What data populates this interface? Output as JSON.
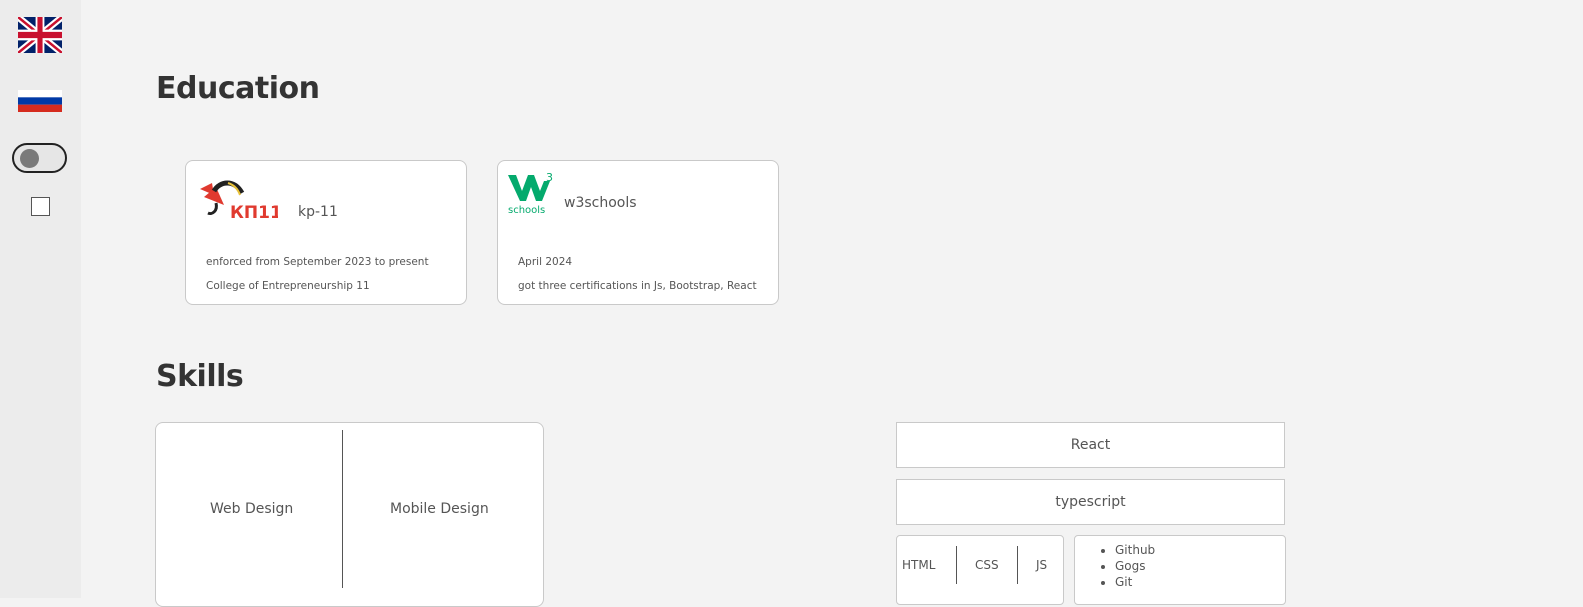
{
  "sidebar": {
    "languages": [
      {
        "code": "en",
        "icon": "uk-flag-icon"
      },
      {
        "code": "ru",
        "icon": "russia-flag-icon"
      }
    ],
    "theme_toggle": {
      "state": "off"
    },
    "checkbox": {
      "checked": false
    }
  },
  "education": {
    "heading": "Education",
    "cards": [
      {
        "logo": "kp11-logo",
        "logo_text": "КП11",
        "title": "kp-11",
        "line1": "enforced from September 2023 to present",
        "line2": "College of Entrepreneurship 11"
      },
      {
        "logo": "w3schools-logo",
        "logo_text": "schools",
        "logo_sup": "3",
        "title": "w3schools",
        "line1": "April 2024",
        "line2": "got three certifications in Js, Bootstrap, React"
      }
    ]
  },
  "skills": {
    "heading": "Skills",
    "design": [
      "Web Design",
      "Mobile Design"
    ],
    "frameworks": [
      "React",
      "typescript"
    ],
    "languages": [
      "HTML",
      "CSS",
      "JS"
    ],
    "tools": [
      "Github",
      "Gogs",
      "Git"
    ]
  },
  "colors": {
    "background": "#f3f3f3",
    "sidebar": "#ececec",
    "kp_red": "#e03a2f",
    "w3_green": "#04aa6d"
  }
}
